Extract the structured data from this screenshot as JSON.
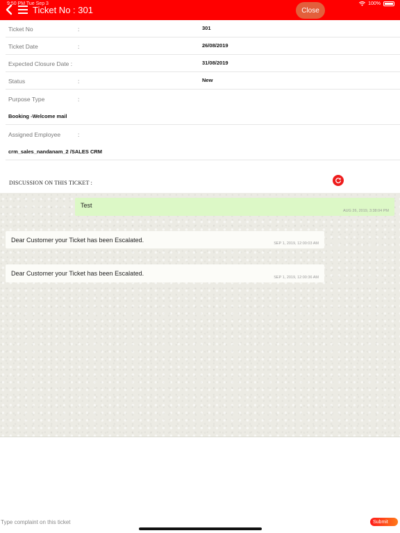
{
  "status_bar": {
    "time": "9:50 PM  Tue Sep 3",
    "battery": "100%"
  },
  "header": {
    "title": "Ticket No : 301",
    "close_label": "Close"
  },
  "details": {
    "ticket_no": {
      "label": "Ticket No",
      "colon": ":",
      "value": "301"
    },
    "ticket_date": {
      "label": "Ticket Date",
      "colon": ":",
      "value": "26/08/2019"
    },
    "expected_closure": {
      "label": "Expected Closure Date :",
      "value": "31/08/2019"
    },
    "status": {
      "label": "Status",
      "colon": ":",
      "value": "New"
    },
    "purpose_type": {
      "label": "Purpose Type",
      "colon": ":",
      "value": "Booking -Welcome mail"
    },
    "assigned_employee": {
      "label": "Assigned Employee",
      "colon": ":",
      "value": "crm_sales_nandanam_2 /SALES CRM"
    }
  },
  "discussion": {
    "label": "DISCUSSION ON THIS TICKET :",
    "messages": [
      {
        "text": "Test",
        "time": "AUG 26, 2019, 3:38:04 PM",
        "direction": "outgoing"
      },
      {
        "text": "Dear Customer your Ticket has been Escalated.",
        "time": "SEP 1, 2019, 12:00:03 AM",
        "direction": "incoming"
      },
      {
        "text": "Dear Customer your Ticket has been Escalated.",
        "time": "SEP 1, 2019, 12:00:36 AM",
        "direction": "incoming"
      }
    ]
  },
  "footer": {
    "placeholder": "Type complaint on this ticket",
    "submit_label": "Submit"
  },
  "colors": {
    "header": "#ff0000",
    "close_button": "#e35f3c",
    "outgoing_bubble": "#dcf8c6",
    "incoming_bubble": "#fcfcf8",
    "refresh_button": "#ee1c1c"
  },
  "icons": {
    "back": "chevron-left-icon",
    "menu": "hamburger-menu-icon",
    "refresh": "refresh-icon",
    "wifi": "wifi-icon",
    "battery": "battery-icon"
  }
}
